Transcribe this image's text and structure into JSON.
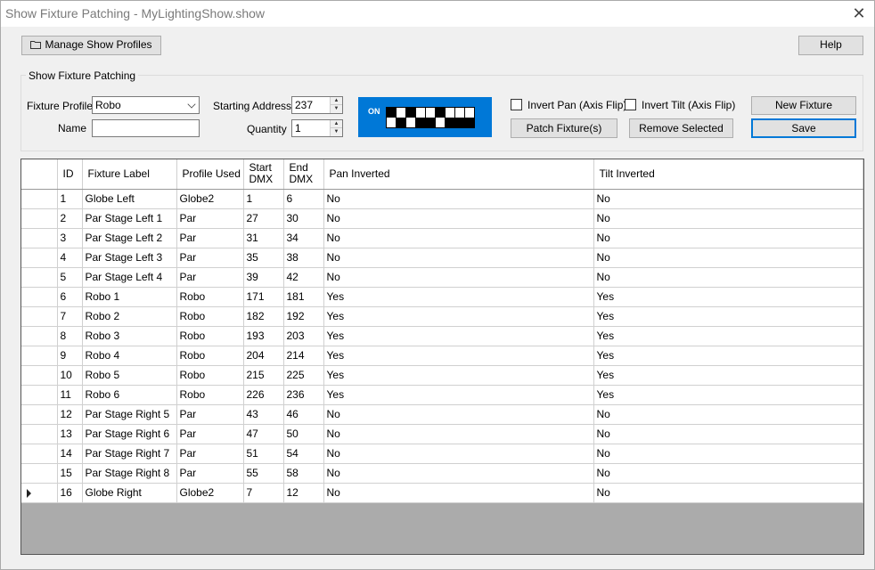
{
  "window": {
    "title": "Show Fixture Patching - MyLightingShow.show"
  },
  "toolbar": {
    "manage_profiles_label": "Manage Show Profiles",
    "help_label": "Help"
  },
  "group": {
    "title": "Show Fixture Patching",
    "fixture_profile_label": "Fixture Profile",
    "fixture_profile_value": "Robo",
    "name_label": "Name",
    "name_value": "",
    "starting_address_label": "Starting Address",
    "starting_address_value": "237",
    "quantity_label": "Quantity",
    "quantity_value": "1",
    "dip_on_label": "ON",
    "dip_switches": [
      "up",
      "down",
      "up",
      "down",
      "down",
      "up",
      "down",
      "down",
      "down"
    ],
    "invert_pan_label": "Invert Pan (Axis Flip)",
    "invert_pan_checked": false,
    "invert_tilt_label": "Invert Tilt (Axis Flip)",
    "invert_tilt_checked": false,
    "patch_label": "Patch Fixture(s)",
    "remove_label": "Remove Selected",
    "new_fixture_label": "New Fixture",
    "save_label": "Save"
  },
  "grid": {
    "columns": [
      "ID",
      "Fixture Label",
      "Profile Used",
      "Start DMX",
      "End DMX",
      "Pan Inverted",
      "Tilt Inverted"
    ],
    "rows": [
      [
        "1",
        "Globe Left",
        "Globe2",
        "1",
        "6",
        "No",
        "No"
      ],
      [
        "2",
        "Par Stage Left 1",
        "Par",
        "27",
        "30",
        "No",
        "No"
      ],
      [
        "3",
        "Par Stage Left 2",
        "Par",
        "31",
        "34",
        "No",
        "No"
      ],
      [
        "4",
        "Par Stage Left 3",
        "Par",
        "35",
        "38",
        "No",
        "No"
      ],
      [
        "5",
        "Par Stage Left 4",
        "Par",
        "39",
        "42",
        "No",
        "No"
      ],
      [
        "6",
        "Robo 1",
        "Robo",
        "171",
        "181",
        "Yes",
        "Yes"
      ],
      [
        "7",
        "Robo 2",
        "Robo",
        "182",
        "192",
        "Yes",
        "Yes"
      ],
      [
        "8",
        "Robo 3",
        "Robo",
        "193",
        "203",
        "Yes",
        "Yes"
      ],
      [
        "9",
        "Robo 4",
        "Robo",
        "204",
        "214",
        "Yes",
        "Yes"
      ],
      [
        "10",
        "Robo 5",
        "Robo",
        "215",
        "225",
        "Yes",
        "Yes"
      ],
      [
        "11",
        "Robo 6",
        "Robo",
        "226",
        "236",
        "Yes",
        "Yes"
      ],
      [
        "12",
        "Par Stage Right 5",
        "Par",
        "43",
        "46",
        "No",
        "No"
      ],
      [
        "13",
        "Par Stage Right 6",
        "Par",
        "47",
        "50",
        "No",
        "No"
      ],
      [
        "14",
        "Par Stage Right 7",
        "Par",
        "51",
        "54",
        "No",
        "No"
      ],
      [
        "15",
        "Par Stage Right 8",
        "Par",
        "55",
        "58",
        "No",
        "No"
      ],
      [
        "16",
        "Globe Right",
        "Globe2",
        "7",
        "12",
        "No",
        "No"
      ]
    ],
    "current_row_index": 15
  },
  "colors": {
    "accent": "#0078d7",
    "grid_empty": "#ababab"
  }
}
